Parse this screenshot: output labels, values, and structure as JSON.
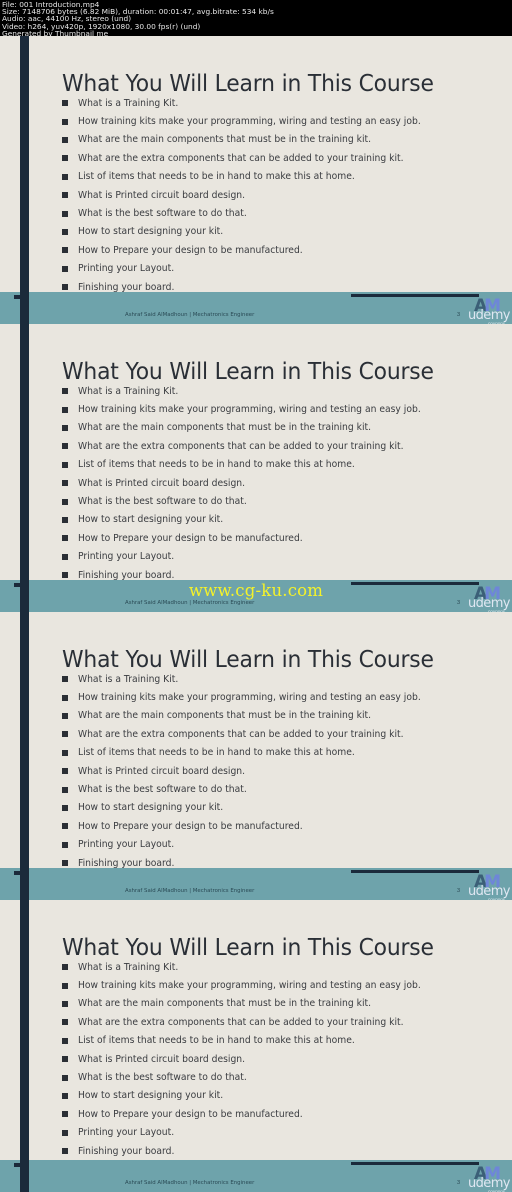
{
  "file_info": {
    "lines": [
      "File: 001 Introduction.mp4",
      "Size: 7148706 bytes (6.82 MiB), duration: 00:01:47, avg.bitrate: 534 kb/s",
      "Audio: aac, 44100 Hz, stereo (und)",
      "Video: h264, yuv420p, 1920x1080, 30.00 fps(r) (und)",
      "Generated by Thumbnail me"
    ]
  },
  "slide": {
    "title": "What You Will Learn in This Course",
    "bullets": [
      "What is a Training Kit.",
      "How training kits make your programming, wiring and testing an easy job.",
      "What are the main components that must be in the training kit.",
      "What are the extra components that can be added to your training kit.",
      "List of items that needs to be in hand to make this at home.",
      "What is Printed circuit board design.",
      "What is the best software to do that.",
      "How to start designing your kit.",
      "How to Prepare your design to be manufactured.",
      "Printing your Layout.",
      "Finishing your board."
    ],
    "footer_author": "Ashraf Said AlMadhoun | Mechatronics Engineer",
    "page_number": "3",
    "logo": {
      "letters_a": "A",
      "letters_m": "M",
      "brand": "udemy",
      "sub": "coupons"
    }
  },
  "frames": [
    {
      "index": 1,
      "watermark": null
    },
    {
      "index": 2,
      "watermark": "www.cg-ku.com"
    },
    {
      "index": 3,
      "watermark": null
    },
    {
      "index": 4,
      "watermark": null
    }
  ],
  "colors": {
    "slide_background": "#e9e6df",
    "footer_band": "#6ea3ab",
    "navy_accent": "#1b2a3b",
    "watermark": "#f4f22a"
  }
}
